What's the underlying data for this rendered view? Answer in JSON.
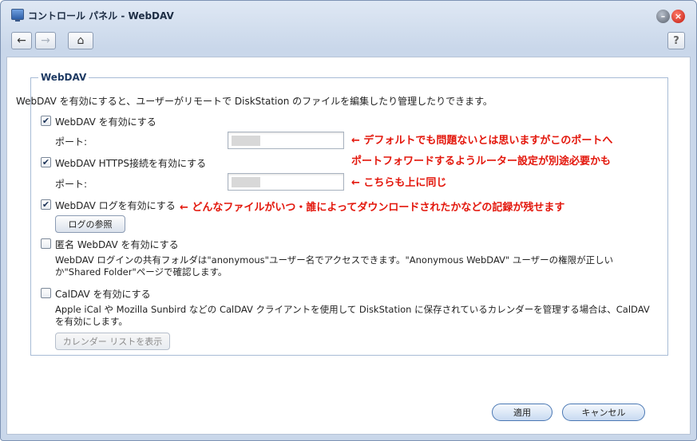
{
  "window": {
    "title": "コントロール パネル - WebDAV"
  },
  "toolbar": {
    "back": "←",
    "forward": "→",
    "home": "⌂",
    "help": "?"
  },
  "panel": {
    "legend": "WebDAV",
    "intro": "WebDAV を有効にすると、ユーザーがリモートで DiskStation のファイルを編集したり管理したりできます。",
    "enable_webdav": {
      "label": "WebDAV を有効にする",
      "checked": true
    },
    "port1_label": "ポート:",
    "enable_https": {
      "label": "WebDAV HTTPS接続を有効にする",
      "checked": true
    },
    "port2_label": "ポート:",
    "enable_log": {
      "label": "WebDAV ログを有効にする",
      "checked": true
    },
    "log_button": "ログの参照",
    "anonymous": {
      "label": "匿名 WebDAV を有効にする",
      "checked": false,
      "desc1": "WebDAV ログインの共有フォルダは\"anonymous\"ユーザー名でアクセスできます。\"Anonymous WebDAV\" ユーザーの権限が正しい",
      "desc2": "か\"Shared Folder\"ページで確認します。"
    },
    "caldav": {
      "label": "CalDAV を有効にする",
      "checked": false,
      "desc1": "Apple iCal や Mozilla Sunbird などの CalDAV クライアントを使用して DiskStation に保存されているカレンダーを管理する場合は、CalDAV",
      "desc2": "を有効にします。",
      "button": "カレンダー リストを表示"
    }
  },
  "annotations": {
    "note1": "← デフォルトでも問題ないとは思いますがこのポートへ",
    "note2": "ポートフォワードするようルーター設定が別途必要かも",
    "note3": "← こちらも上に同じ",
    "note4": "← どんなファイルがいつ・誰によってダウンロードされたかなどの記録が残せます"
  },
  "footer": {
    "apply": "適用",
    "cancel": "キャンセル"
  },
  "colors": {
    "annotation": "#e3160b",
    "accent": "#1e3a63"
  }
}
